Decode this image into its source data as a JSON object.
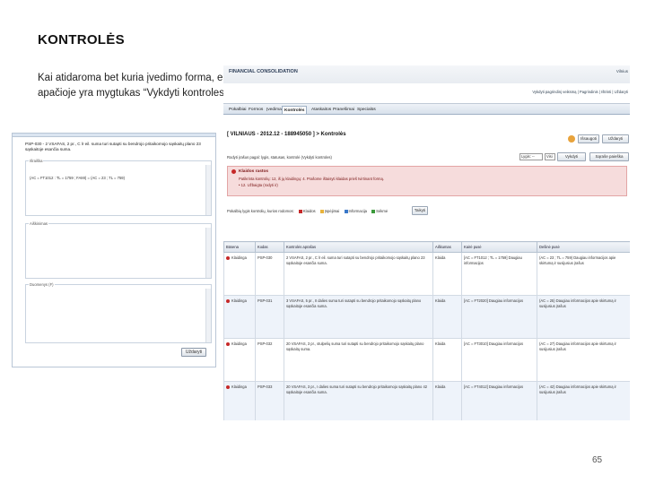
{
  "slide": {
    "title": "KONTROLĖS",
    "caption": "Kai atidaroma bet kuria įvedimo forma, ekrano apačioje yra mygtukas “Vykdyti kontroles”",
    "page_number": "65"
  },
  "dialog": {
    "message": "PSP-030 - 2 VSAFAS, 2 pr., C lr eil. suma turi sutapti su bendrojo pritaikomojo sąskaitų plano 23 sąskaitoje esančia suma.",
    "field1_label": "Išraiška",
    "field1_value": "(AC = FT1012 : TL = 1759 ; FAMI) = (AC = 23 ; TL = 759)",
    "field2_label": "Aiškinimas",
    "field3_label": "Duomenys (F)",
    "ok_label": "Uždaryti"
  },
  "app": {
    "logo": "FINANCIAL CONSOLIDATION",
    "brand": "Vilnius",
    "userline": "Vykdyti pagrindinį veiksmą | Pagrindinis | Ištrinti | Uždaryti",
    "menu_tabs": [
      "Pokalbiai",
      "Formos",
      "Įvedimas",
      "Kontrolės",
      "Ataskaitos",
      "Pranešimai",
      "Specialūs"
    ],
    "header": "[ VILNIAUS - 2012.12 - 188945050 ] > Kontrolės",
    "buttons": {
      "save": "Išsaugoti",
      "close": "Uždaryti",
      "run": "Vykdyti",
      "second": "Sąraše paieška"
    },
    "filter_text": "Rodyti įrašus pagal: lygis, statusas, kontrolė (Vykdyti kontroles)",
    "filter_select": "Lygis: --",
    "filter_select2": "Visi",
    "error": {
      "title": "Klaidos rastos",
      "line1": "Patikrinta kontrolių: 12, iš jų klaidingų: 4. Prašome ištaisyti klaidas prieš tvirtinant formą.",
      "line2": "• 12. Užbaigta (rodyti ir)"
    },
    "legend_text": "Pokalbių lygis kontrolių, kurios rodomos:",
    "legend_items": [
      "Klaidos",
      "Įspėjimai",
      "Informacija",
      "Sėkmė"
    ],
    "legend_apply": "Taikyti",
    "table": {
      "headers": [
        "Būsena",
        "Kodas",
        "Kontrolės aprašas",
        "Aiškumas",
        "Kairė pusė",
        "Dešinė pusė"
      ],
      "rows": [
        {
          "status": "Klaidinga",
          "code": "PSP-030",
          "desc": "2 VSAFAS, 2 pr., C lr eil. suma turi sutapti su bendrojo pritaikomojo sąskaitų plano 23 sąskaitoje esančia suma.",
          "level": "Klaida",
          "left": "[AC = FT1012 ; TL = 1759] Daugiau informacijos",
          "right": "(AC = 23 ; TL = 759) Daugiau informacijos apie skirtumą ir susijusius įrašus"
        },
        {
          "status": "Klaidinga",
          "code": "PSP-031",
          "desc": "3 VSAFAS, 5 pr., II dalies suma turi sutapti su bendrojo pritaikomojo sąskaitų plano sąskaitoje esančia suma.",
          "level": "Klaida",
          "left": "[AC = FT2020] Daugiau informacijos",
          "right": "(AC = 25) Daugiau informacijos apie skirtumą ir susijusius įrašus"
        },
        {
          "status": "Klaidinga",
          "code": "PSP-032",
          "desc": "20 VSAFAS, 3 pr., stulpelių suma turi sutapti su bendrojo pritaikomojo sąskaitų plano sąskaitų suma.",
          "level": "Klaida",
          "left": "[AC = FT3010] Daugiau informacijos",
          "right": "(AC = 27) Daugiau informacijos apie skirtumą ir susijusius įrašus"
        },
        {
          "status": "Klaidinga",
          "code": "PSP-033",
          "desc": "20 VSAFAS, 3 pr., I dalies suma turi sutapti su bendrojo pritaikomojo sąskaitų plano 42 sąskaitoje esančia suma.",
          "level": "Klaida",
          "left": "[AC = FT4012] Daugiau informacijos",
          "right": "(AC = 42) Daugiau informacijos apie skirtumą ir susijusius įrašus"
        }
      ]
    }
  }
}
